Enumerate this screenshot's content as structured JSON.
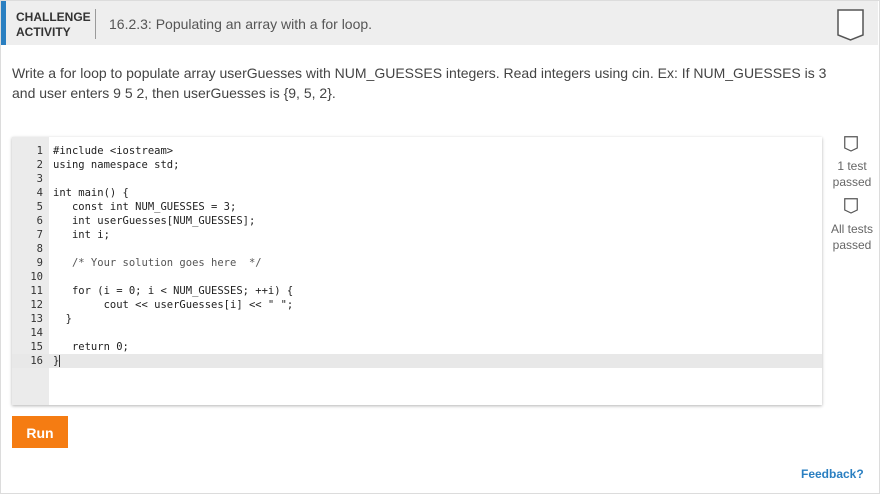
{
  "header": {
    "label_line1": "CHALLENGE",
    "label_line2": "ACTIVITY",
    "title": "16.2.3: Populating an array with a for loop."
  },
  "prompt": "Write a for loop to populate array userGuesses with NUM_GUESSES integers. Read integers using cin. Ex: If NUM_GUESSES is 3 and user enters 9 5 2, then userGuesses is {9, 5, 2}.",
  "editor": {
    "lines": [
      {
        "n": "1",
        "t": "#include <iostream>"
      },
      {
        "n": "2",
        "t": "using namespace std;"
      },
      {
        "n": "3",
        "t": ""
      },
      {
        "n": "4",
        "t": "int main() {"
      },
      {
        "n": "5",
        "t": "   const int NUM_GUESSES = 3;"
      },
      {
        "n": "6",
        "t": "   int userGuesses[NUM_GUESSES];"
      },
      {
        "n": "7",
        "t": "   int i;"
      },
      {
        "n": "8",
        "t": ""
      },
      {
        "n": "9",
        "t": "   /* Your solution goes here  */"
      },
      {
        "n": "10",
        "t": ""
      },
      {
        "n": "11",
        "t": "   for (i = 0; i < NUM_GUESSES; ++i) {"
      },
      {
        "n": "12",
        "t": "        cout << userGuesses[i] << \" \";"
      },
      {
        "n": "13",
        "t": "  }"
      },
      {
        "n": "14",
        "t": ""
      },
      {
        "n": "15",
        "t": "   return 0;"
      },
      {
        "n": "16",
        "t": "}"
      }
    ]
  },
  "tests": {
    "one_line1": "1 test",
    "one_line2": "passed",
    "all_line1": "All tests",
    "all_line2": "passed"
  },
  "run_label": "Run",
  "feedback_label": "Feedback?"
}
